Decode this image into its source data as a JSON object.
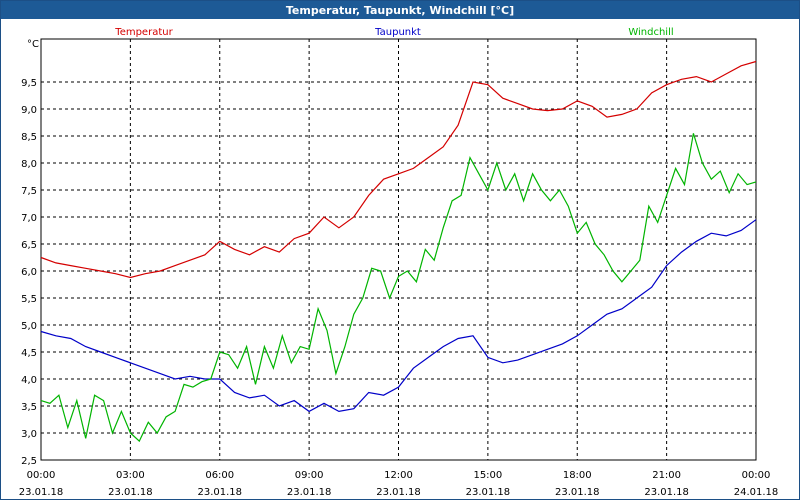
{
  "window": {
    "title": "Temperatur, Taupunkt, Windchill [°C]"
  },
  "chart_data": {
    "type": "line",
    "title": "Temperatur, Taupunkt, Windchill [°C]",
    "unit": "°C",
    "ylim": [
      2.5,
      10.0
    ],
    "yticks": [
      "2,5",
      "3,0",
      "3,5",
      "4,0",
      "4,5",
      "5,0",
      "5,5",
      "6,0",
      "6,5",
      "7,0",
      "7,5",
      "8,0",
      "8,5",
      "9,0",
      "9,5"
    ],
    "ytick_values": [
      2.5,
      3.0,
      3.5,
      4.0,
      4.5,
      5.0,
      5.5,
      6.0,
      6.5,
      7.0,
      7.5,
      8.0,
      8.5,
      9.0,
      9.5
    ],
    "xlim": [
      0,
      24
    ],
    "xtick_hours": [
      0,
      3,
      6,
      9,
      12,
      15,
      18,
      21,
      24
    ],
    "xtick_times": [
      "00:00",
      "03:00",
      "06:00",
      "09:00",
      "12:00",
      "15:00",
      "18:00",
      "21:00",
      "00:00"
    ],
    "xtick_dates": [
      "23.01.18",
      "23.01.18",
      "23.01.18",
      "23.01.18",
      "23.01.18",
      "23.01.18",
      "23.01.18",
      "23.01.18",
      "24.01.18"
    ],
    "grid": true,
    "legend_position": "top",
    "series": [
      {
        "name": "Temperatur",
        "color": "#d40000",
        "x": [
          0,
          0.5,
          1,
          1.5,
          2,
          2.5,
          3,
          3.5,
          4,
          4.5,
          5,
          5.5,
          6,
          6.5,
          7,
          7.5,
          8,
          8.5,
          9,
          9.5,
          10,
          10.5,
          11,
          11.5,
          12,
          12.5,
          13,
          13.5,
          14,
          14.5,
          15,
          15.5,
          16,
          16.5,
          17,
          17.5,
          18,
          18.5,
          19,
          19.5,
          20,
          20.5,
          21,
          21.5,
          22,
          22.5,
          23,
          23.5,
          24
        ],
        "values": [
          6.25,
          6.15,
          6.1,
          6.05,
          6.0,
          5.95,
          5.88,
          5.95,
          6.0,
          6.1,
          6.2,
          6.3,
          6.55,
          6.4,
          6.3,
          6.45,
          6.35,
          6.6,
          6.7,
          7.0,
          6.8,
          7.0,
          7.4,
          7.7,
          7.8,
          7.9,
          8.1,
          8.3,
          8.7,
          9.5,
          9.45,
          9.2,
          9.1,
          9.0,
          8.97,
          9.0,
          9.15,
          9.05,
          8.85,
          8.9,
          9.0,
          9.3,
          9.45,
          9.55,
          9.6,
          9.5,
          9.65,
          9.8,
          9.88
        ]
      },
      {
        "name": "Taupunkt",
        "color": "#0000c8",
        "x": [
          0,
          0.5,
          1,
          1.5,
          2,
          2.5,
          3,
          3.5,
          4,
          4.5,
          5,
          5.5,
          6,
          6.5,
          7,
          7.5,
          8,
          8.5,
          9,
          9.5,
          10,
          10.5,
          11,
          11.5,
          12,
          12.5,
          13,
          13.5,
          14,
          14.5,
          15,
          15.5,
          16,
          16.5,
          17,
          17.5,
          18,
          18.5,
          19,
          19.5,
          20,
          20.5,
          21,
          21.5,
          22,
          22.5,
          23,
          23.5,
          24
        ],
        "values": [
          4.88,
          4.8,
          4.75,
          4.6,
          4.5,
          4.4,
          4.3,
          4.2,
          4.1,
          4.0,
          4.05,
          4.0,
          4.0,
          3.75,
          3.65,
          3.7,
          3.5,
          3.6,
          3.4,
          3.55,
          3.4,
          3.45,
          3.75,
          3.7,
          3.85,
          4.2,
          4.4,
          4.6,
          4.75,
          4.8,
          4.4,
          4.3,
          4.35,
          4.45,
          4.55,
          4.65,
          4.8,
          5.0,
          5.2,
          5.3,
          5.5,
          5.7,
          6.1,
          6.35,
          6.55,
          6.7,
          6.65,
          6.75,
          6.95
        ]
      },
      {
        "name": "Windchill",
        "color": "#00b400",
        "x": [
          0,
          0.3,
          0.6,
          0.9,
          1.2,
          1.5,
          1.8,
          2.1,
          2.4,
          2.7,
          3.0,
          3.3,
          3.6,
          3.9,
          4.2,
          4.5,
          4.8,
          5.1,
          5.4,
          5.7,
          6.0,
          6.3,
          6.6,
          6.9,
          7.2,
          7.5,
          7.8,
          8.1,
          8.4,
          8.7,
          9.0,
          9.3,
          9.6,
          9.9,
          10.2,
          10.5,
          10.8,
          11.1,
          11.4,
          11.7,
          12.0,
          12.3,
          12.6,
          12.9,
          13.2,
          13.5,
          13.8,
          14.1,
          14.4,
          14.7,
          15.0,
          15.3,
          15.6,
          15.9,
          16.2,
          16.5,
          16.8,
          17.1,
          17.4,
          17.7,
          18.0,
          18.3,
          18.6,
          18.9,
          19.2,
          19.5,
          19.8,
          20.1,
          20.4,
          20.7,
          21.0,
          21.3,
          21.6,
          21.9,
          22.2,
          22.5,
          22.8,
          23.1,
          23.4,
          23.7,
          24.0
        ],
        "values": [
          3.6,
          3.55,
          3.7,
          3.1,
          3.6,
          2.9,
          3.7,
          3.6,
          3.0,
          3.4,
          3.0,
          2.85,
          3.2,
          3.0,
          3.3,
          3.4,
          3.9,
          3.85,
          3.95,
          4.0,
          4.5,
          4.45,
          4.2,
          4.6,
          3.9,
          4.6,
          4.2,
          4.8,
          4.3,
          4.6,
          4.55,
          5.3,
          4.9,
          4.1,
          4.6,
          5.2,
          5.5,
          6.05,
          6.0,
          5.5,
          5.9,
          6.0,
          5.8,
          6.4,
          6.2,
          6.8,
          7.3,
          7.4,
          8.1,
          7.8,
          7.5,
          8.0,
          7.5,
          7.8,
          7.3,
          7.8,
          7.5,
          7.3,
          7.5,
          7.2,
          6.7,
          6.9,
          6.5,
          6.3,
          6.0,
          5.8,
          6.0,
          6.2,
          7.2,
          6.9,
          7.4,
          7.9,
          7.6,
          8.55,
          8.0,
          7.7,
          7.85,
          7.45,
          7.8,
          7.6,
          7.65
        ]
      }
    ]
  }
}
